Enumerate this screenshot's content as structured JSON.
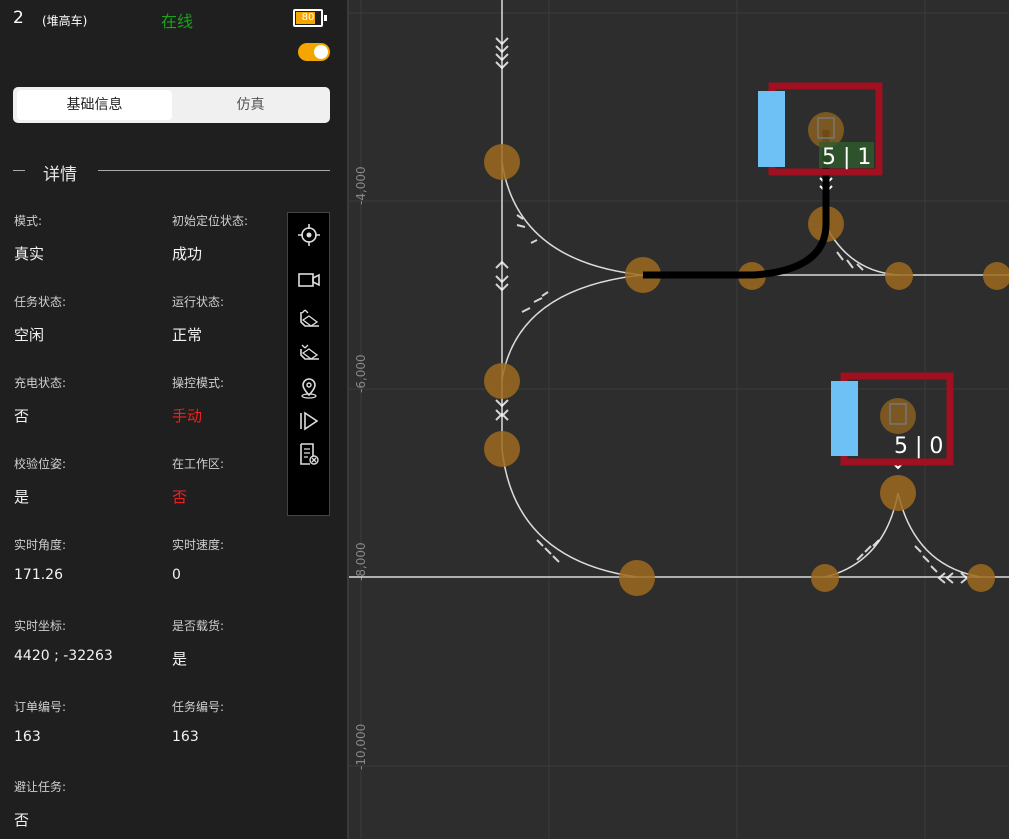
{
  "header": {
    "vehicle_id": "2",
    "vehicle_type": "(堆高车)",
    "status": "在线",
    "battery": "80",
    "battery_level": 0.8,
    "toggle_on": true
  },
  "tabs": [
    {
      "label": "基础信息",
      "active": true
    },
    {
      "label": "仿真",
      "active": false
    }
  ],
  "section_title": "详情",
  "details": [
    {
      "label": "模式:",
      "value": "真实"
    },
    {
      "label": "初始定位状态:",
      "value": "成功"
    },
    {
      "label": "任务状态:",
      "value": "空闲"
    },
    {
      "label": "运行状态:",
      "value": "正常"
    },
    {
      "label": "充电状态:",
      "value": "否"
    },
    {
      "label": "操控模式:",
      "value": "手动"
    },
    {
      "label": "校验位姿:",
      "value": "是"
    },
    {
      "label": "在工作区:",
      "value": "否"
    },
    {
      "label": "实时角度:",
      "value": "171.26"
    },
    {
      "label": "实时速度:",
      "value": "0"
    },
    {
      "label": "实时坐标:",
      "value": "4420 ; -32263"
    },
    {
      "label": "是否载货:",
      "value": "是"
    },
    {
      "label": "订单编号:",
      "value": "163"
    },
    {
      "label": "任务编号:",
      "value": "163"
    },
    {
      "label": "避让任务:",
      "value": "否"
    }
  ],
  "toolbar": [
    {
      "icon": "locate-crosshair-icon"
    },
    {
      "icon": "camera-icon"
    },
    {
      "icon": "forklift-up-icon"
    },
    {
      "icon": "forklift-down-icon"
    },
    {
      "icon": "map-pin-icon"
    },
    {
      "icon": "play-step-icon"
    },
    {
      "icon": "document-cancel-icon"
    }
  ],
  "map": {
    "axis_ticks": [
      "-4,000",
      "-6,000",
      "-8,000",
      "-10,000"
    ],
    "vehicles": [
      {
        "label": "5 | 1"
      },
      {
        "label": "5 | 0"
      }
    ],
    "colors": {
      "background": "#2d2d2d",
      "node": "#9c6a1e",
      "vehicle_frame": "#a01020",
      "vehicle_side": "#6ec1f5",
      "route": "#000000",
      "path": "#dcdcdc"
    }
  },
  "colors": {
    "online": "#1aa31a",
    "accent": "#f5a500",
    "alert": "#f02020",
    "panel_bg": "#1f1f1f"
  }
}
